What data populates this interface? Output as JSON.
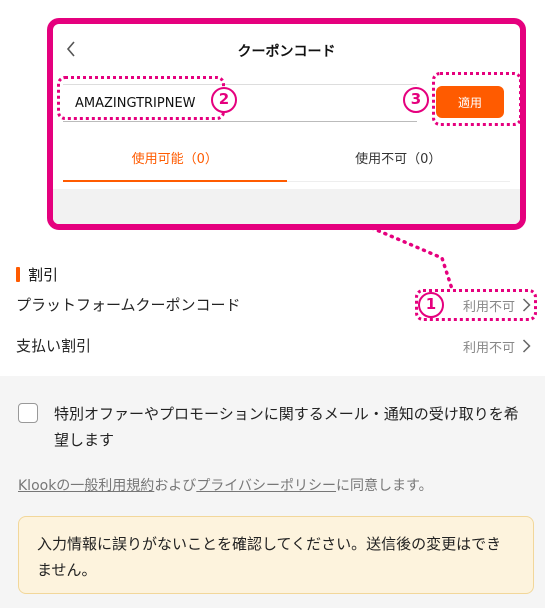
{
  "popup": {
    "title": "クーポンコード",
    "code_value": "AMAZINGTRIPNEW",
    "apply_label": "適用",
    "tabs": [
      {
        "label": "使用可能（0）"
      },
      {
        "label": "使用不可（0）"
      }
    ]
  },
  "callouts": {
    "one": "1",
    "two": "2",
    "three": "3"
  },
  "discount": {
    "heading": "割引",
    "rows": [
      {
        "label": "プラットフォームクーポンコード",
        "status": "利用不可"
      },
      {
        "label": "支払い割引",
        "status": "利用不可"
      }
    ]
  },
  "optin": {
    "text": "特別オファーやプロモーションに関するメール・通知の受け取りを希望します"
  },
  "terms": {
    "link1": "Klookの一般利用規約",
    "mid": "および",
    "link2": "プライバシーポリシー",
    "end": "に同意します。"
  },
  "notice": {
    "text": "入力情報に誤りがないことを確認してください。送信後の変更はできません。"
  },
  "colors": {
    "accent": "#ff5b00",
    "annotation": "#e5007e"
  }
}
